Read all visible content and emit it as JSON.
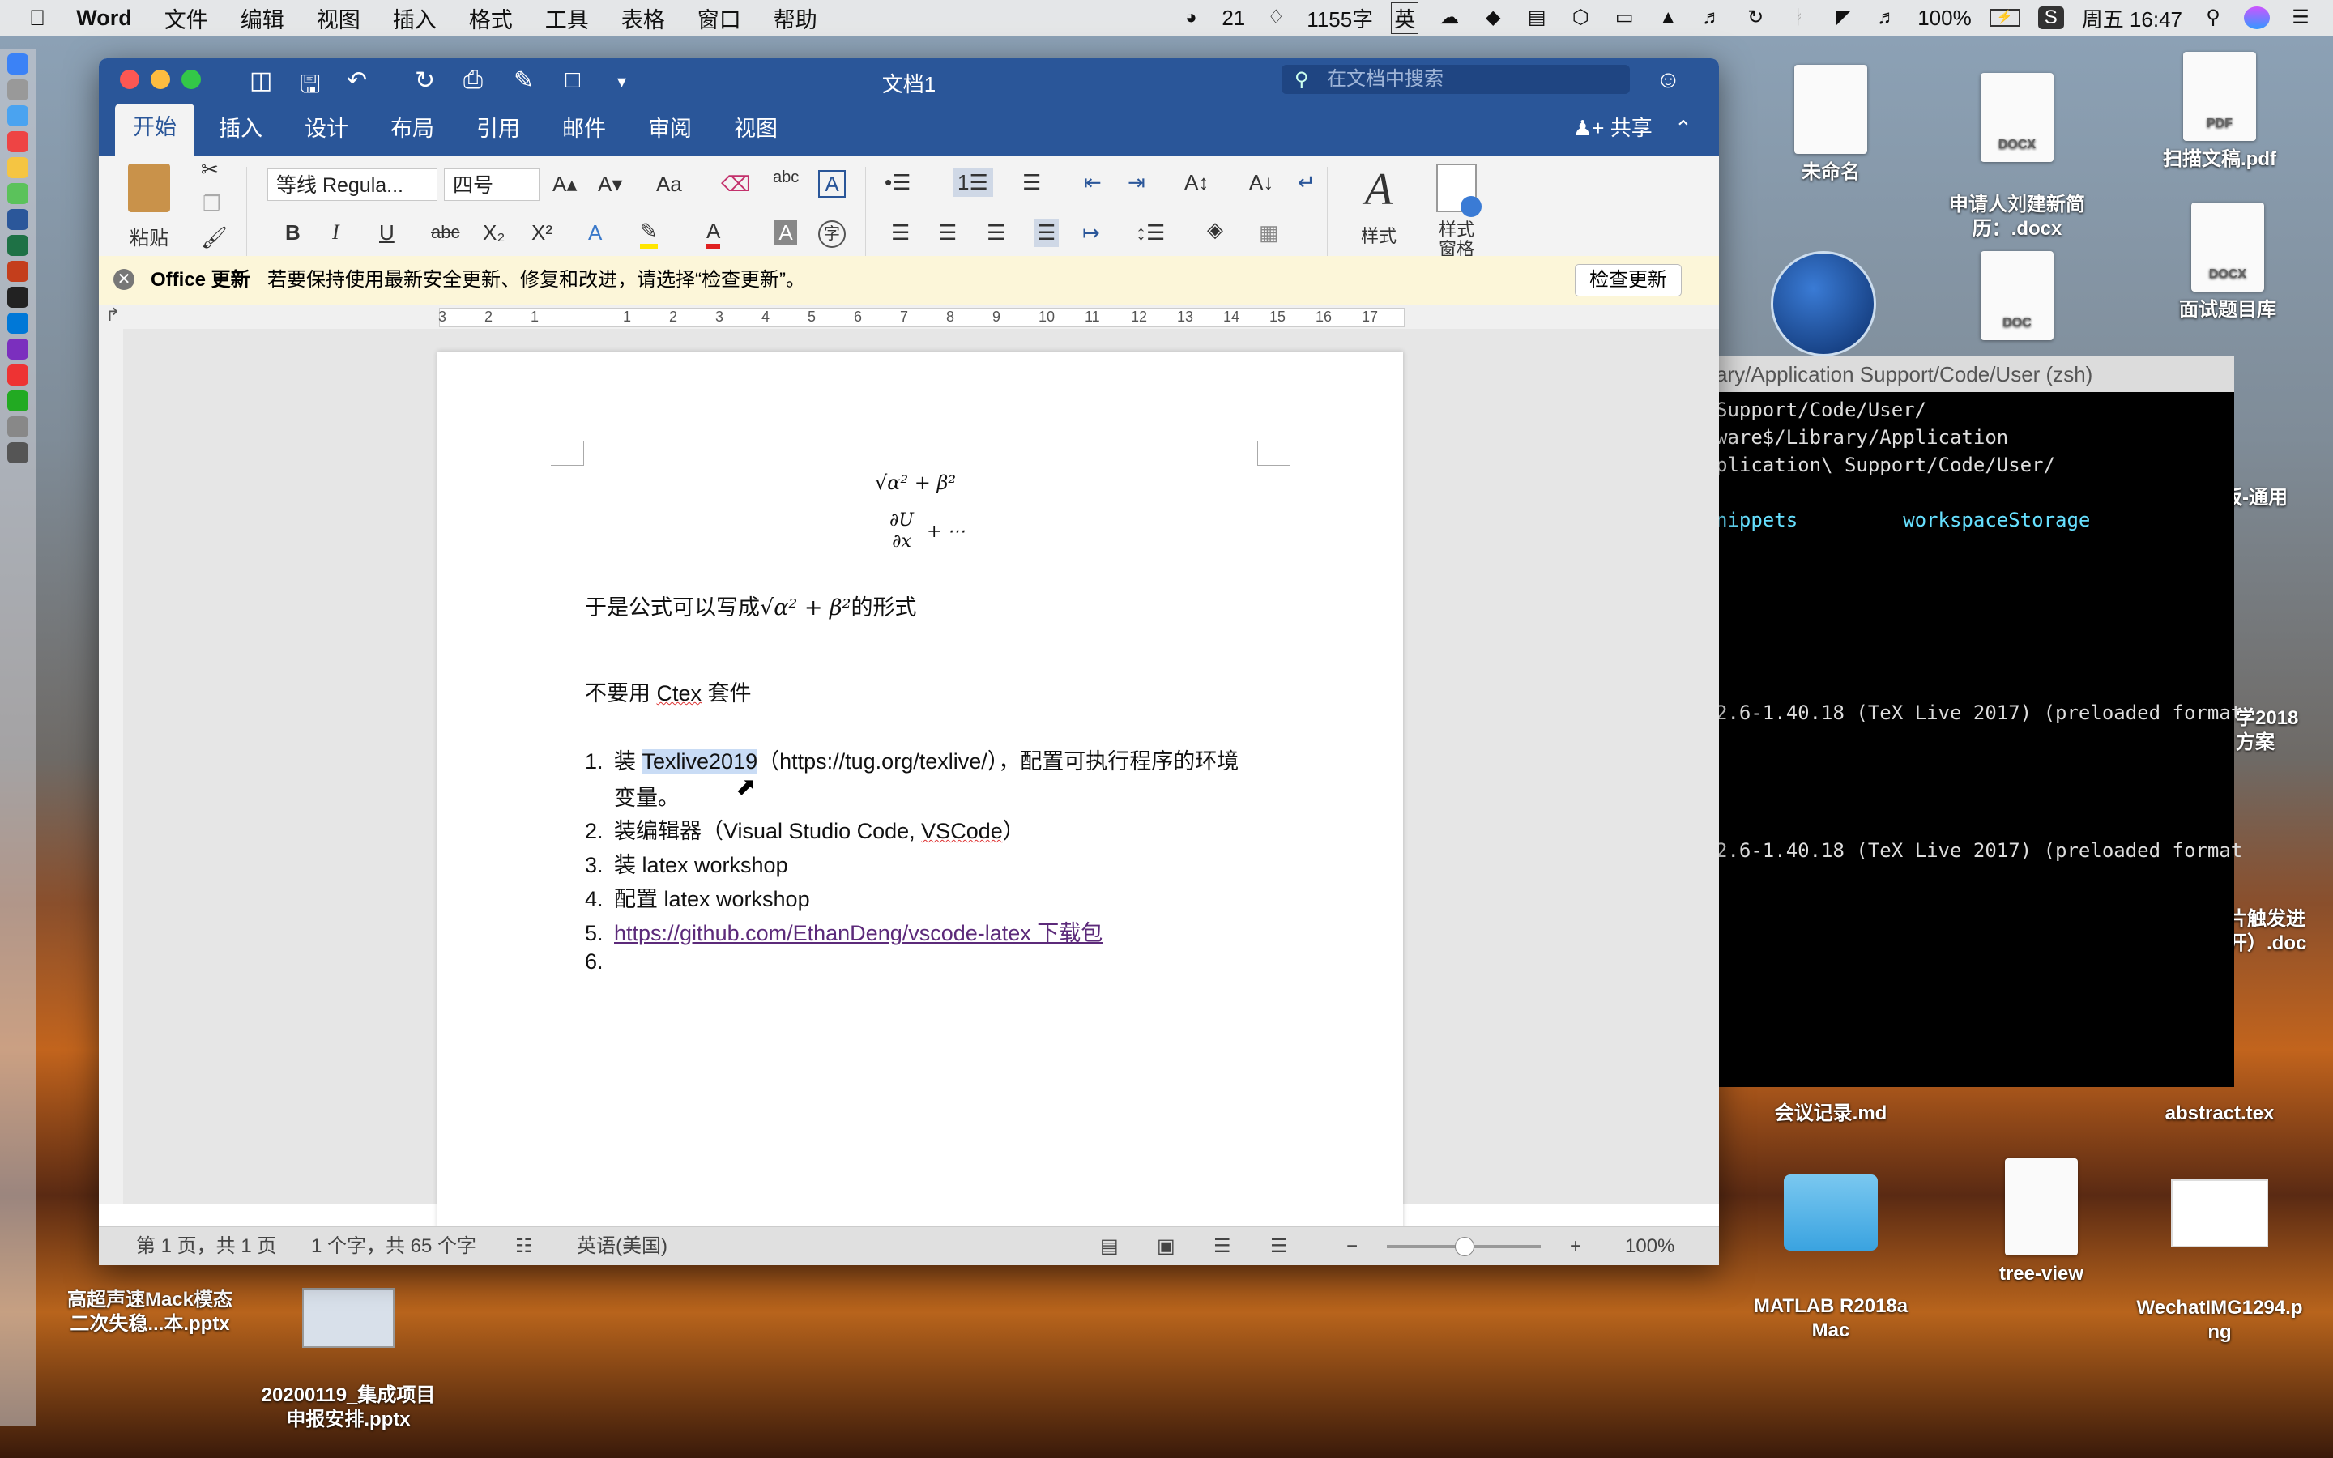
{
  "menubar": {
    "apple": "",
    "app": "Word",
    "items": [
      "文件",
      "编辑",
      "视图",
      "插入",
      "格式",
      "工具",
      "表格",
      "窗口",
      "帮助"
    ],
    "wechat_count": "21",
    "word_count": "1155字",
    "ime": "英",
    "battery": "100%",
    "clock": "周五 16:47"
  },
  "word": {
    "title": "文档1",
    "search_placeholder": "在文档中搜索",
    "tabs": [
      "开始",
      "插入",
      "设计",
      "布局",
      "引用",
      "邮件",
      "审阅",
      "视图"
    ],
    "share": "共享",
    "ribbon": {
      "paste": "粘贴",
      "font_name": "等线 Regula...",
      "font_size": "四号",
      "styles": "样式",
      "styles_pane": "样式\n窗格",
      "bold": "B",
      "italic": "I",
      "underline": "U",
      "strike": "abc",
      "subscript": "X₂",
      "superscript": "X²"
    },
    "update_bar": {
      "title": "Office 更新",
      "message": "若要保持使用最新安全更新、修复和改进，请选择“检查更新”。",
      "button": "检查更新"
    },
    "ruler_numbers": [
      "3",
      "2",
      "1",
      "",
      "1",
      "2",
      "3",
      "4",
      "5",
      "6",
      "7",
      "8",
      "9",
      "10",
      "11",
      "12",
      "13",
      "14",
      "15",
      "16",
      "17"
    ],
    "document": {
      "formula1": "√α² + β²",
      "formula2_num": "∂U",
      "formula2_den": "∂x",
      "formula2_tail": "+ ⋯",
      "para1_before": "于是公式可以写成",
      "para1_math": "√α² + β²",
      "para1_after": "的形式",
      "para2_a": "不要用 ",
      "para2_b": "Ctex",
      "para2_c": " 套件",
      "list": [
        {
          "num": "1.",
          "a": "装 ",
          "b": "Texlive2019",
          "c": "（https://tug.org/texlive/），配置可执行程序的环境",
          "cont": "变量。"
        },
        {
          "num": "2.",
          "a": "装编辑器（Visual Studio Code, ",
          "b": "VSCode",
          "c": "）"
        },
        {
          "num": "3.",
          "a": "装 latex workshop"
        },
        {
          "num": "4.",
          "a": "配置 latex workshop"
        },
        {
          "num": "5.",
          "link": "https://github.com/EthanDeng/vscode-latex 下载包"
        },
        {
          "num": "6.",
          "a": ""
        }
      ]
    },
    "status": {
      "page": "第 1 页，共 1 页",
      "words": "1 个字，共 65 个字",
      "language": "英语(美国)",
      "zoom": "100%",
      "zoom_level": 0.5
    }
  },
  "terminal": {
    "title": "ary/Application Support/Code/User (zsh)",
    "lines": [
      "Support/Code/User/",
      "ware$/Library/Application",
      "plication\\ Support/Code/User/",
      "",
      "nippets         workspaceStorage",
      "2.6-1.40.18 (TeX Live 2017) (preloaded format",
      "2.6-1.40.18 (TeX Live 2017) (preloaded format"
    ]
  },
  "desktop": {
    "icons": [
      {
        "label": "未命名",
        "kind": ""
      },
      {
        "label": "申请人刘建新简\n历：.docx",
        "kind": "DOCX"
      },
      {
        "label": "扫描文稿.pdf",
        "kind": "PDF"
      },
      {
        "label": "面试题目库",
        "kind": "DOCX"
      },
      {
        "label": "",
        "kind": "DOC"
      },
      {
        "label": "会议记录.md",
        "kind": ""
      },
      {
        "label": "abstract.tex",
        "kind": ""
      },
      {
        "label": "MATLAB R2018a\nMac",
        "kind": "folder"
      },
      {
        "label": "tree-view",
        "kind": ""
      },
      {
        "label": "WechatIMG1294.p\nng",
        "kind": "img"
      },
      {
        "label": "高超声速Mack模态\n二次失稳...本.pptx",
        "kind": ""
      },
      {
        "label": "20200119_集成项目\n申报安排.pptx",
        "kind": ""
      }
    ],
    "partial_labels": [
      "模板-通用",
      "学2018\n方案",
      "片触发进\n开）.doc"
    ]
  }
}
